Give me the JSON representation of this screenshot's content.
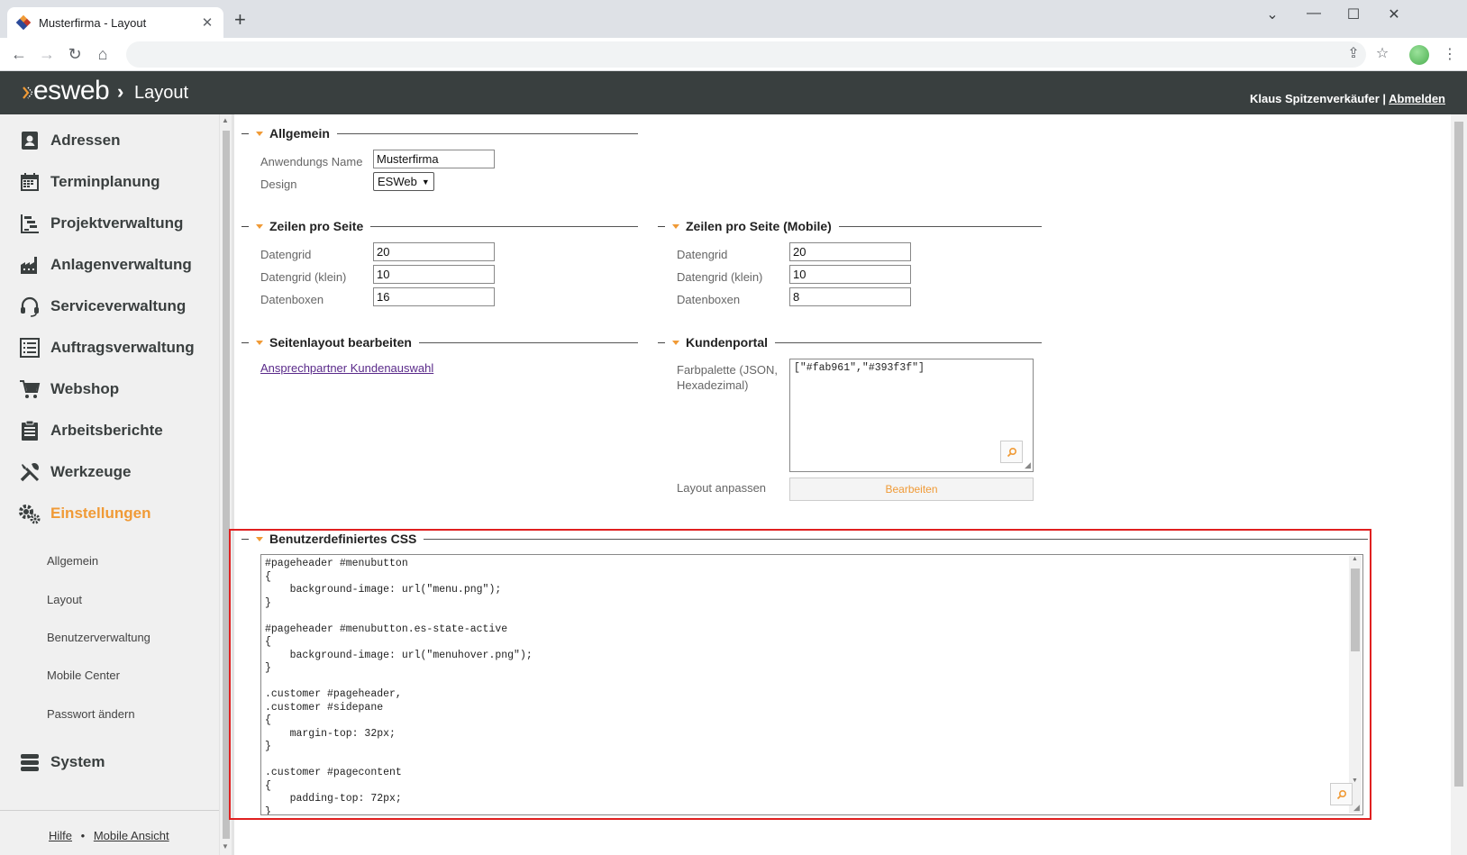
{
  "browser": {
    "tab_title": "Musterfirma - Layout",
    "tab_close": "✕",
    "new_tab": "+",
    "window": {
      "minimize": "⌄",
      "min": "—",
      "max": "☐",
      "close": "✕"
    },
    "nav": {
      "back": "←",
      "forward": "→",
      "reload": "↻",
      "home": "⌂"
    },
    "toolbar": {
      "share": "⇪",
      "bookmark": "☆",
      "menu": "⋮"
    }
  },
  "header": {
    "logo_text": "esweb",
    "separator": "›",
    "page": "Layout",
    "user": "Klaus Spitzenverkäufer",
    "divider": " | ",
    "logout": "Abmelden"
  },
  "sidebar": {
    "items": [
      {
        "label": "Adressen",
        "icon": "address-book-icon"
      },
      {
        "label": "Terminplanung",
        "icon": "calendar-icon"
      },
      {
        "label": "Projektverwaltung",
        "icon": "gantt-icon"
      },
      {
        "label": "Anlagenverwaltung",
        "icon": "factory-icon"
      },
      {
        "label": "Serviceverwaltung",
        "icon": "headset-icon"
      },
      {
        "label": "Auftragsverwaltung",
        "icon": "list-icon"
      },
      {
        "label": "Webshop",
        "icon": "cart-icon"
      },
      {
        "label": "Arbeitsberichte",
        "icon": "clipboard-icon"
      },
      {
        "label": "Werkzeuge",
        "icon": "tools-icon"
      },
      {
        "label": "Einstellungen",
        "icon": "gears-icon"
      }
    ],
    "subitems": [
      "Allgemein",
      "Layout",
      "Benutzerverwaltung",
      "Mobile Center",
      "Passwort ändern"
    ],
    "system": "System",
    "footer": {
      "help": "Hilfe",
      "sep": "•",
      "mobile": "Mobile Ansicht"
    }
  },
  "colors": {
    "accent": "#f09a36",
    "header_bg": "#393f3f",
    "highlight": "#e02020",
    "link": "#5a2a8a"
  },
  "allgemein": {
    "title": "Allgemein",
    "name_label": "Anwendungs Name",
    "name_value": "Musterfirma",
    "design_label": "Design",
    "design_value": "ESWeb"
  },
  "zeilen": {
    "title": "Zeilen pro Seite",
    "rows": [
      {
        "label": "Datengrid",
        "value": "20"
      },
      {
        "label": "Datengrid (klein)",
        "value": "10"
      },
      {
        "label": "Datenboxen",
        "value": "16"
      }
    ]
  },
  "zeilen_mobile": {
    "title": "Zeilen pro Seite (Mobile)",
    "rows": [
      {
        "label": "Datengrid",
        "value": "20"
      },
      {
        "label": "Datengrid (klein)",
        "value": "10"
      },
      {
        "label": "Datenboxen",
        "value": "8"
      }
    ]
  },
  "seitenlayout": {
    "title": "Seitenlayout bearbeiten",
    "link": "Ansprechpartner Kundenauswahl"
  },
  "kundenportal": {
    "title": "Kundenportal",
    "palette_label_1": "Farbpalette (JSON,",
    "palette_label_2": "Hexadezimal)",
    "palette_value": "[\"#fab961\",\"#393f3f\"]",
    "layout_label": "Layout anpassen",
    "edit_button": "Bearbeiten"
  },
  "css": {
    "title": "Benutzerdefiniertes CSS",
    "code": "#pageheader #menubutton\n{\n    background-image: url(\"menu.png\");\n}\n\n#pageheader #menubutton.es-state-active\n{\n    background-image: url(\"menuhover.png\");\n}\n\n.customer #pageheader,\n.customer #sidepane\n{\n    margin-top: 32px;\n}\n\n.customer #pagecontent\n{\n    padding-top: 72px;\n}"
  }
}
